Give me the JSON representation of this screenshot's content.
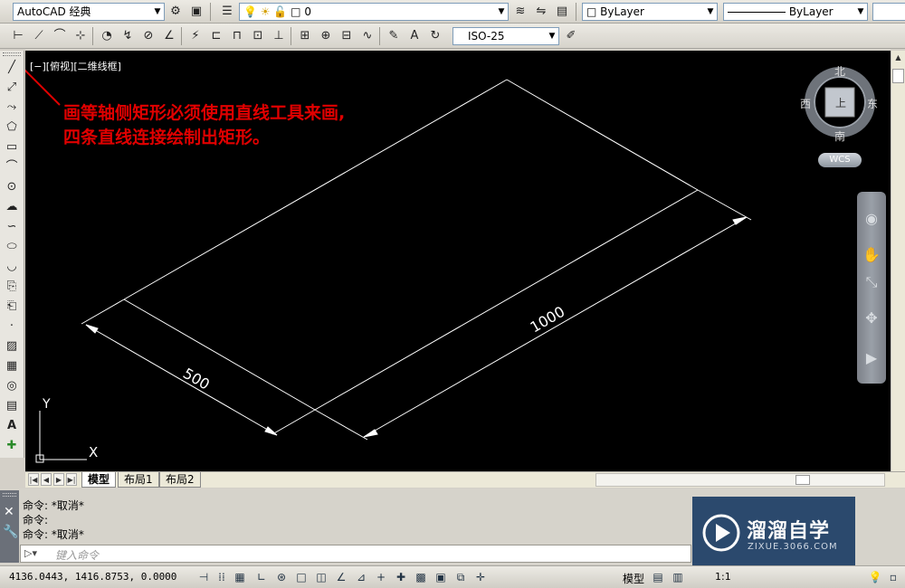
{
  "toolbar1": {
    "workspace": "AutoCAD 经典",
    "layer": "0",
    "color": "ByLayer",
    "linetype": "ByLayer"
  },
  "toolbar2": {
    "dimstyle": "ISO-25"
  },
  "canvas": {
    "viewport_label": "[−][俯视][二维线框]",
    "annotation_lines": [
      "画等轴侧矩形必须使用直线工具来画,",
      "四条直线连接绘制出矩形。"
    ],
    "dimension_short": "500",
    "dimension_long": "1000",
    "ucs_y": "Y",
    "ucs_x": "X"
  },
  "viewcube": {
    "north": "北",
    "south": "南",
    "east": "东",
    "west": "西",
    "face": "上",
    "wcs": "WCS"
  },
  "tabs": {
    "model": "模型",
    "layout1": "布局1",
    "layout2": "布局2"
  },
  "command": {
    "history": [
      "命令: *取消*",
      "命令:",
      "命令: *取消*"
    ],
    "placeholder": "键入命令"
  },
  "status": {
    "coordinates": "4136.0443, 1416.8753, 0.0000",
    "model_label": "模型",
    "scale": "1:1"
  },
  "watermark": {
    "title": "溜溜自学",
    "url": "ZIXUE.3066.COM"
  },
  "colors": {
    "canvas_bg": "#000000",
    "annotation": "#e00000",
    "lines": "#ffffff"
  }
}
